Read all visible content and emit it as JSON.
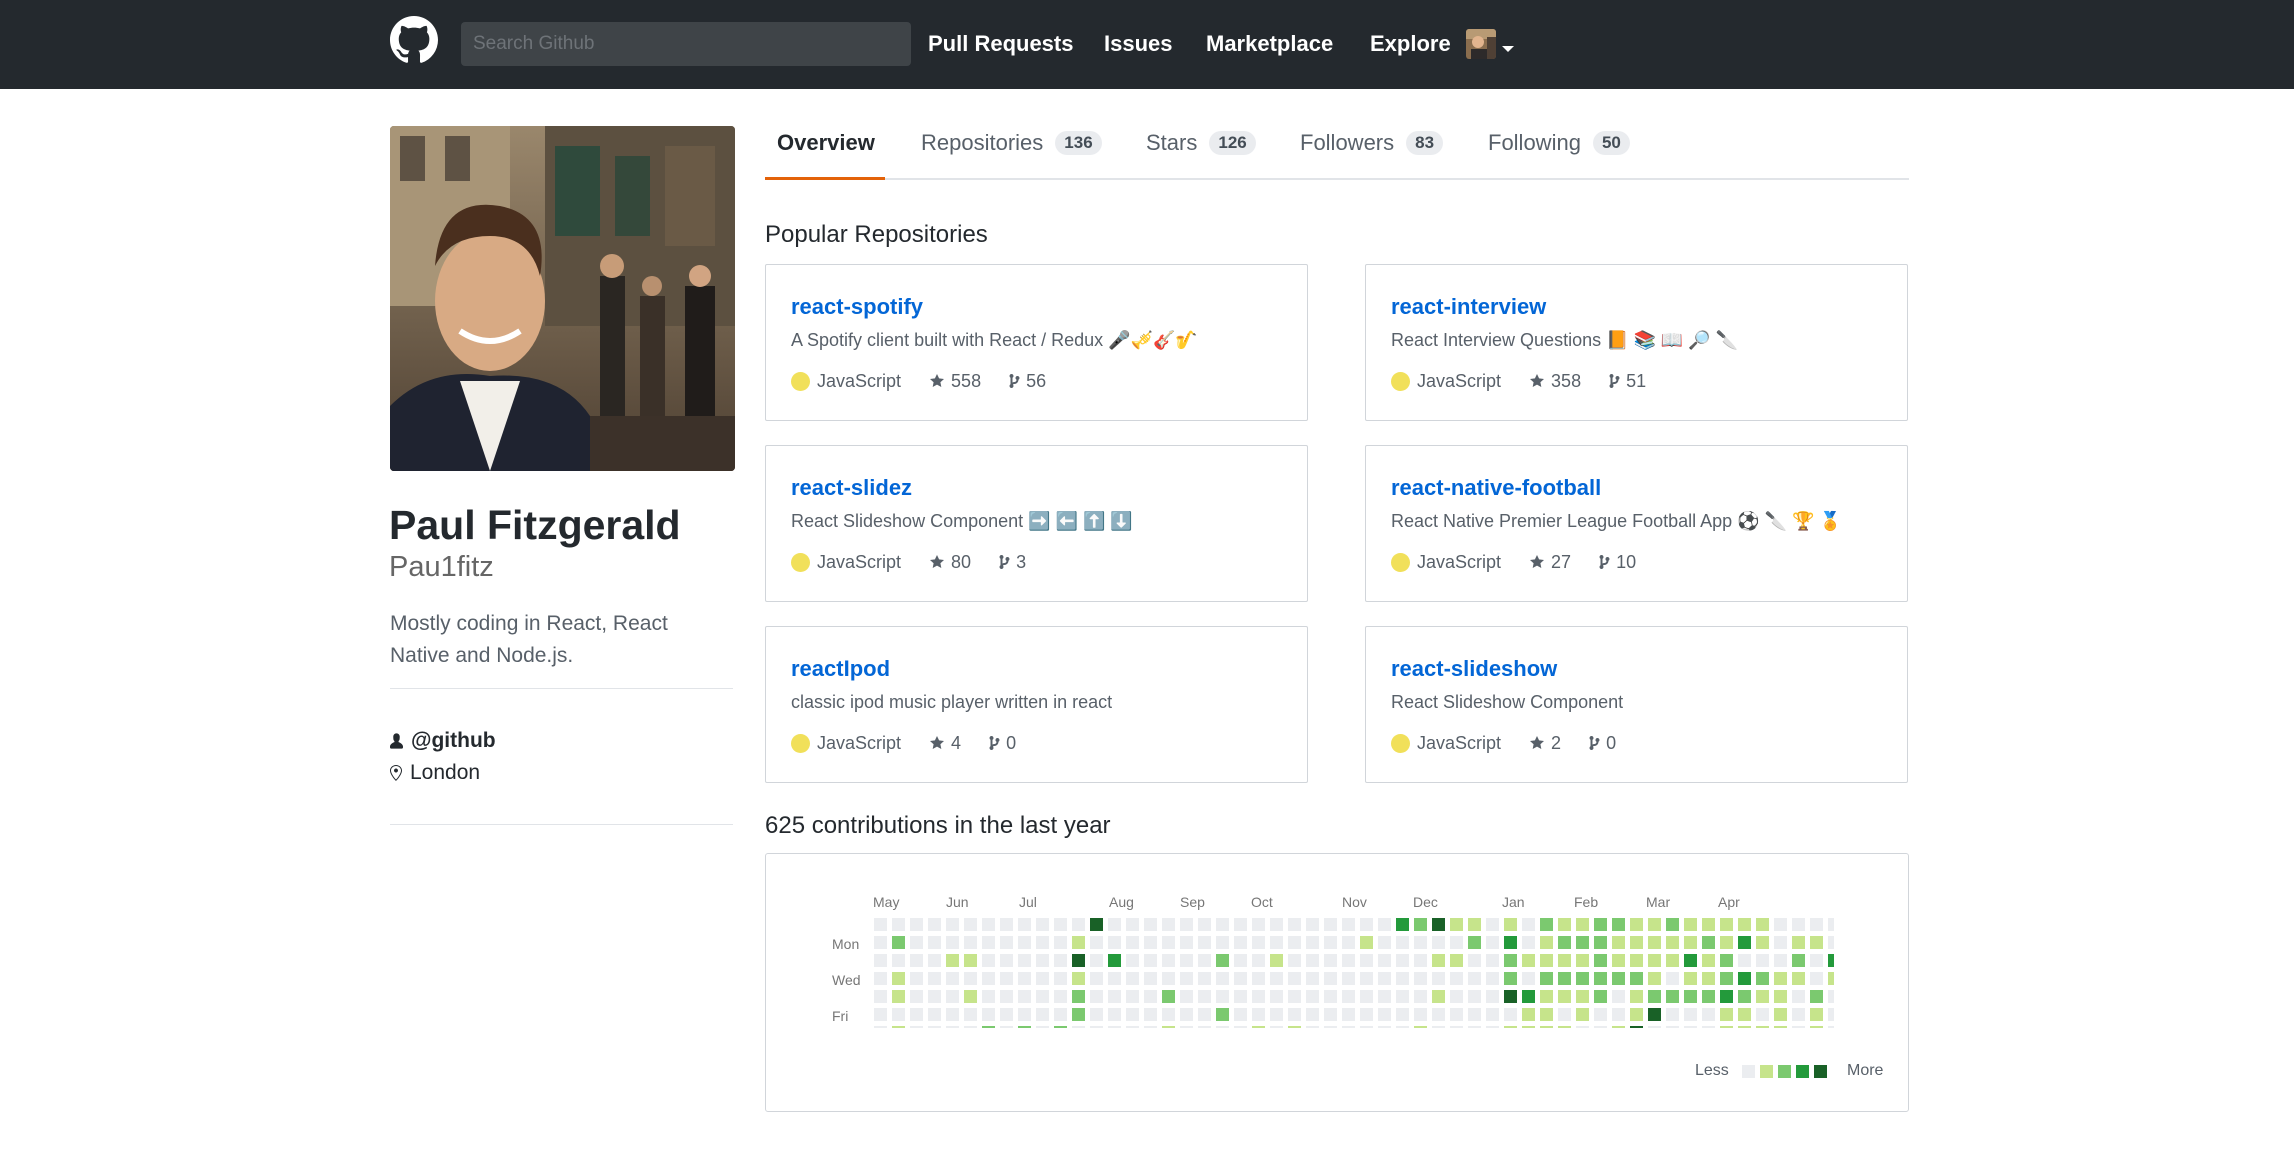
{
  "header": {
    "search_placeholder": "Search Github",
    "nav": [
      "Pull Requests",
      "Issues",
      "Marketplace",
      "Explore"
    ]
  },
  "profile": {
    "fullname": "Paul Fitzgerald",
    "username": "Pau1fitz",
    "bio": "Mostly coding in React, React Native and Node.js.",
    "company": "@github",
    "location": "London"
  },
  "tabs": [
    {
      "label": "Overview",
      "count": null
    },
    {
      "label": "Repositories",
      "count": "136"
    },
    {
      "label": "Stars",
      "count": "126"
    },
    {
      "label": "Followers",
      "count": "83"
    },
    {
      "label": "Following",
      "count": "50"
    }
  ],
  "popular_title": "Popular Repositories",
  "repos": [
    {
      "name": "react-spotify",
      "desc": "A Spotify client built with React / Redux 🎤🎺🎸🎷",
      "lang": "JavaScript",
      "stars": "558",
      "forks": "56"
    },
    {
      "name": "react-interview",
      "desc": "React Interview Questions 📙 📚 📖 🔎 🔪",
      "lang": "JavaScript",
      "stars": "358",
      "forks": "51"
    },
    {
      "name": "react-slidez",
      "desc": "React Slideshow Component ➡️ ⬅️ ⬆️ ⬇️",
      "lang": "JavaScript",
      "stars": "80",
      "forks": "3"
    },
    {
      "name": "react-native-football",
      "desc": "React Native Premier League Football App ⚽ 🔪 🏆 🏅",
      "lang": "JavaScript",
      "stars": "27",
      "forks": "10"
    },
    {
      "name": "reactIpod",
      "desc": "classic ipod music player written in react",
      "lang": "JavaScript",
      "stars": "4",
      "forks": "0"
    },
    {
      "name": "react-slideshow",
      "desc": "React Slideshow Component",
      "lang": "JavaScript",
      "stars": "2",
      "forks": "0"
    }
  ],
  "contributions": {
    "title": "625 contributions in the last year",
    "months": [
      "May",
      "Jun",
      "Jul",
      "Aug",
      "Sep",
      "Oct",
      "Nov",
      "Dec",
      "Jan",
      "Feb",
      "Mar",
      "Apr"
    ],
    "day_labels": [
      "Mon",
      "Wed",
      "Fri"
    ],
    "legend_less": "Less",
    "legend_more": "More",
    "colors": [
      "#ebedf0",
      "#c6e48b",
      "#7bc96f",
      "#239a3b",
      "#196127"
    ],
    "level_rows": [
      "00000000000040000000000000000324110102112211211111000000",
      "02000000000100000000000000010000020301222111112131011020",
      "00001100000403000002001000000001100211112111131200020300",
      "01000000000100000000000000000000000202222221011232110100",
      "01000100000200002000000000000001000431112012222321102002",
      "00000000000200000002000000000000000011010014000110101040",
      "01000020202000001000010100000010000111100140000111101010",
      "00000000000000000000000000000000000000000000000000000000"
    ]
  },
  "colors": {
    "header_bg": "#24292e",
    "link": "#0366d6",
    "tab_accent": "#e36209",
    "js_lang": "#f1e05a"
  }
}
